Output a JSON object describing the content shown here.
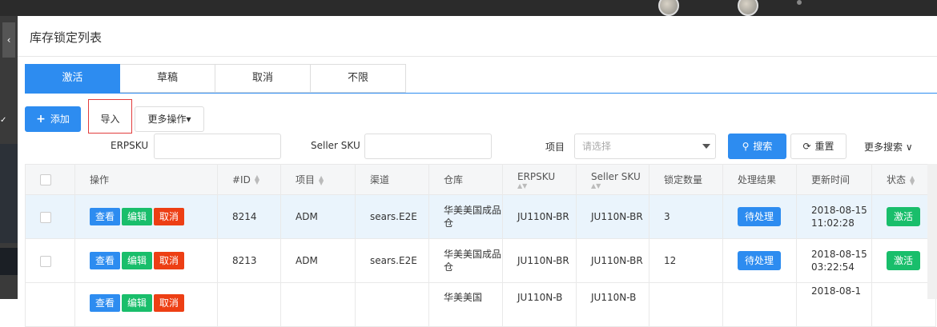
{
  "page": {
    "title": "库存锁定列表",
    "sidebar_toggle_icon": "chevron-left-icon"
  },
  "tabs": [
    {
      "label": "激活",
      "active": true
    },
    {
      "label": "草稿",
      "active": false
    },
    {
      "label": "取消",
      "active": false
    },
    {
      "label": "不限",
      "active": false
    }
  ],
  "toolbar": {
    "add_label": "添加",
    "add_icon": "plus-icon",
    "import_label": "导入",
    "more_ops_label": "更多操作▾"
  },
  "filters": {
    "erpsku_label": "ERPSKU",
    "erpsku_value": "",
    "seller_sku_label": "Seller SKU",
    "seller_sku_value": "",
    "project_label": "项目",
    "project_placeholder": "请选择",
    "search_label": "搜索",
    "search_icon": "search-icon",
    "reset_label": "重置",
    "reset_icon": "refresh-icon",
    "more_search_label": "更多搜索 ∨"
  },
  "table": {
    "headers": {
      "op": "操作",
      "id": "#ID",
      "project": "项目",
      "channel": "渠道",
      "warehouse": "仓库",
      "erpsku": "ERPSKU",
      "seller_sku": "Seller SKU",
      "lock_qty": "锁定数量",
      "result": "处理结果",
      "updated": "更新时间",
      "status": "状态"
    },
    "actions": {
      "view": "查看",
      "edit": "编辑",
      "cancel": "取消"
    },
    "rows": [
      {
        "id": "8214",
        "project": "ADM",
        "channel": "sears.E2E",
        "warehouse": "华美美国成品仓",
        "erpsku": "JU110N-BR",
        "seller_sku": "JU110N-BR",
        "lock_qty": "3",
        "result": "待处理",
        "updated": "2018-08-15 11:02:28",
        "status": "激活"
      },
      {
        "id": "8213",
        "project": "ADM",
        "channel": "sears.E2E",
        "warehouse": "华美美国成品仓",
        "erpsku": "JU110N-BR",
        "seller_sku": "JU110N-BR",
        "lock_qty": "12",
        "result": "待处理",
        "updated": "2018-08-15 03:22:54",
        "status": "激活"
      },
      {
        "id": "",
        "project": "",
        "channel": "",
        "warehouse": "华美美国",
        "erpsku": "JU110N-B",
        "seller_sku": "JU110N-B",
        "lock_qty": "",
        "result": "",
        "updated": "2018-08-1",
        "status": ""
      }
    ]
  },
  "colors": {
    "primary": "#2d8cf0",
    "success": "#19be6b",
    "danger": "#ed3f14",
    "highlight": "#e23d3d"
  }
}
